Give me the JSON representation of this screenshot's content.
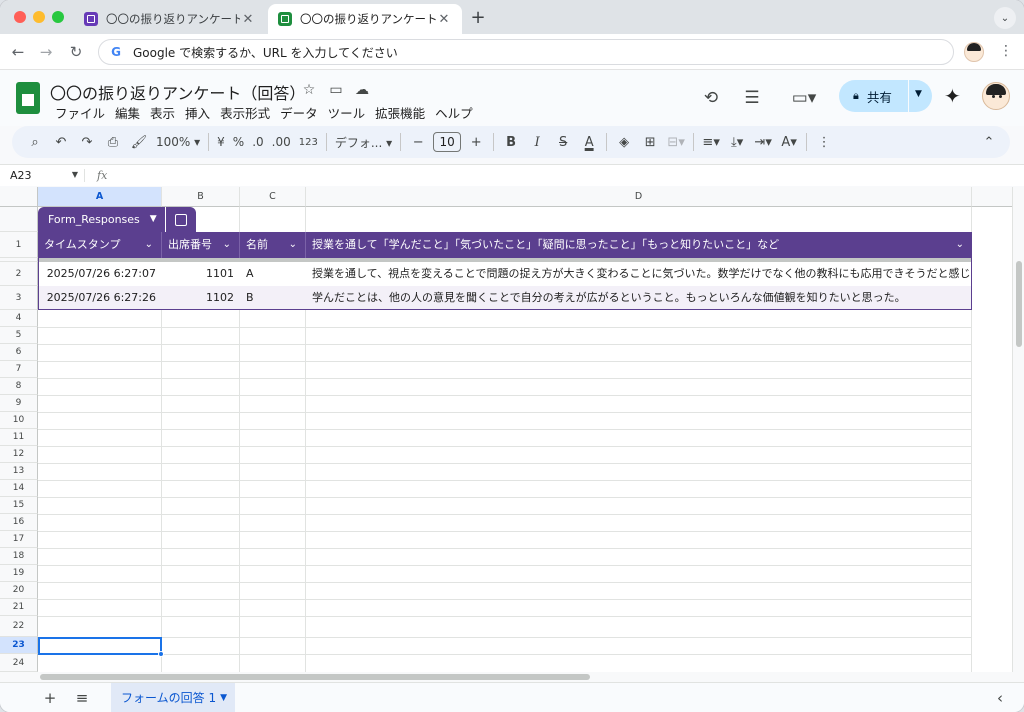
{
  "browser": {
    "tabs": [
      {
        "title": "〇〇の振り返りアンケート - Goo",
        "favicon": "forms-icon"
      },
      {
        "title": "〇〇の振り返りアンケート（回答",
        "favicon": "sheets-icon"
      }
    ],
    "address_placeholder": "Google で検索するか、URL を入力してください"
  },
  "doc": {
    "title": "〇〇の振り返りアンケート（回答）",
    "menu": [
      "ファイル",
      "編集",
      "表示",
      "挿入",
      "表示形式",
      "データ",
      "ツール",
      "拡張機能",
      "ヘルプ"
    ],
    "share_label": "共有"
  },
  "format_toolbar": {
    "zoom": "100%",
    "currency": "¥",
    "percent": "%",
    "dec_decrease": ".0",
    "dec_increase": ".00",
    "number_format": "123",
    "font": "デフォ...",
    "font_size": "10"
  },
  "formula_bar": {
    "name_box": "A23",
    "fx": "fx"
  },
  "columns": [
    "A",
    "B",
    "C",
    "D"
  ],
  "rows": [
    "1",
    "2",
    "3",
    "4",
    "5",
    "6",
    "7",
    "8",
    "9",
    "10",
    "11",
    "12",
    "13",
    "14",
    "15",
    "16",
    "17",
    "18",
    "19",
    "20",
    "21",
    "22",
    "23",
    "24"
  ],
  "table": {
    "name": "Form_Responses",
    "headers": [
      "タイムスタンプ",
      "出席番号",
      "名前",
      "授業を通して「学んだこと」「気づいたこと」「疑問に思ったこと」「もっと知りたいこと」など"
    ],
    "rows": [
      [
        "2025/07/26 6:27:07",
        "1101",
        "A",
        "授業を通して、視点を変えることで問題の捉え方が大きく変わることに気づいた。数学だけでなく他の教科にも応用できそうだと感じ"
      ],
      [
        "2025/07/26 6:27:26",
        "1102",
        "B",
        "学んだことは、他の人の意見を聞くことで自分の考えが広がるということ。もっといろんな価値観を知りたいと思った。"
      ]
    ]
  },
  "sheet_tabs": [
    {
      "label": "フォームの回答 1"
    }
  ],
  "colors": {
    "table_header": "#5b3f8f",
    "selection": "#1a73e8",
    "share": "#c2e7ff"
  }
}
